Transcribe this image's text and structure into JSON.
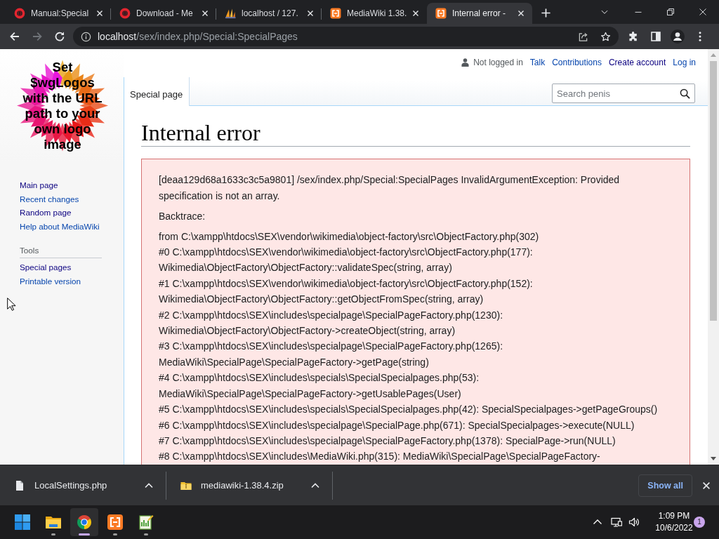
{
  "browser": {
    "tabs": [
      {
        "kind": "ring",
        "title": "Manual:Special",
        "selected": false
      },
      {
        "kind": "ring",
        "title": "Download - Me",
        "selected": false
      },
      {
        "kind": "sail",
        "title": "localhost / 127.",
        "selected": false
      },
      {
        "kind": "tile",
        "title": "MediaWiki 1.38.",
        "selected": false
      },
      {
        "kind": "tile",
        "title": "Internal error -",
        "selected": true
      }
    ],
    "nav_buttons": [
      {
        "kind": "back",
        "disabled": false
      },
      {
        "kind": "forward",
        "disabled": true
      },
      {
        "kind": "reload",
        "disabled": false
      }
    ],
    "address": {
      "host": "localhost",
      "path": "/sex/index.php/Special:SpecialPages"
    }
  },
  "wiki": {
    "logo_text": "Set\n$wgLogos\nwith the URL\npath to your\nown logo\nimage",
    "navigation": [
      {
        "label": "Main page",
        "visited": true
      },
      {
        "label": "Recent changes",
        "visited": false
      },
      {
        "label": "Random page",
        "visited": true
      },
      {
        "label": "Help about MediaWiki",
        "visited": false
      }
    ],
    "tools": {
      "heading": "Tools",
      "items": [
        {
          "label": "Special pages",
          "visited": true
        },
        {
          "label": "Printable version",
          "visited": false
        }
      ]
    },
    "personal": {
      "status": "Not logged in",
      "links": [
        {
          "label": "Talk",
          "visited": false
        },
        {
          "label": "Contributions",
          "visited": false
        },
        {
          "label": "Create account",
          "visited": true
        },
        {
          "label": "Log in",
          "visited": false
        }
      ]
    },
    "tabs": [
      {
        "label": "Special page",
        "selected": true
      }
    ],
    "search": {
      "placeholder": "Search penis"
    },
    "title": "Internal error",
    "error": {
      "message": "[deaa129d68a1633c3c5a9801] /sex/index.php/Special:SpecialPages InvalidArgumentException: Provided specification is not an array.",
      "backtrace_label": "Backtrace:",
      "trace": [
        "from C:\\xampp\\htdocs\\SEX\\vendor\\wikimedia\\object-factory\\src\\ObjectFactory.php(302)",
        "#0 C:\\xampp\\htdocs\\SEX\\vendor\\wikimedia\\object-factory\\src\\ObjectFactory.php(177): Wikimedia\\ObjectFactory\\ObjectFactory::validateSpec(string, array)",
        "#1 C:\\xampp\\htdocs\\SEX\\vendor\\wikimedia\\object-factory\\src\\ObjectFactory.php(152): Wikimedia\\ObjectFactory\\ObjectFactory::getObjectFromSpec(string, array)",
        "#2 C:\\xampp\\htdocs\\SEX\\includes\\specialpage\\SpecialPageFactory.php(1230): Wikimedia\\ObjectFactory\\ObjectFactory->createObject(string, array)",
        "#3 C:\\xampp\\htdocs\\SEX\\includes\\specialpage\\SpecialPageFactory.php(1265): MediaWiki\\SpecialPage\\SpecialPageFactory->getPage(string)",
        "#4 C:\\xampp\\htdocs\\SEX\\includes\\specials\\SpecialSpecialpages.php(53): MediaWiki\\SpecialPage\\SpecialPageFactory->getUsablePages(User)",
        "#5 C:\\xampp\\htdocs\\SEX\\includes\\specials\\SpecialSpecialpages.php(42): SpecialSpecialpages->getPageGroups()",
        "#6 C:\\xampp\\htdocs\\SEX\\includes\\specialpage\\SpecialPage.php(671): SpecialSpecialpages->execute(NULL)",
        "#7 C:\\xampp\\htdocs\\SEX\\includes\\specialpage\\SpecialPageFactory.php(1378): SpecialPage->run(NULL)",
        "#8 C:\\xampp\\htdocs\\SEX\\includes\\MediaWiki.php(315): MediaWiki\\SpecialPage\\SpecialPageFactory-"
      ]
    }
  },
  "downloads": {
    "items": [
      {
        "kind": "file",
        "name": "LocalSettings.php"
      },
      {
        "kind": "archive",
        "name": "mediawiki-1.38.4.zip"
      }
    ],
    "show_all": "Show all"
  },
  "taskbar": {
    "apps": [
      {
        "kind": "start",
        "running": false,
        "selected": false
      },
      {
        "kind": "folder",
        "running": true,
        "selected": false
      },
      {
        "kind": "browser",
        "running": true,
        "selected": true
      },
      {
        "kind": "tile",
        "running": true,
        "selected": false
      },
      {
        "kind": "editor",
        "running": true,
        "selected": false
      }
    ],
    "time": "1:09 PM",
    "date": "10/6/2022",
    "notifications": "1"
  }
}
